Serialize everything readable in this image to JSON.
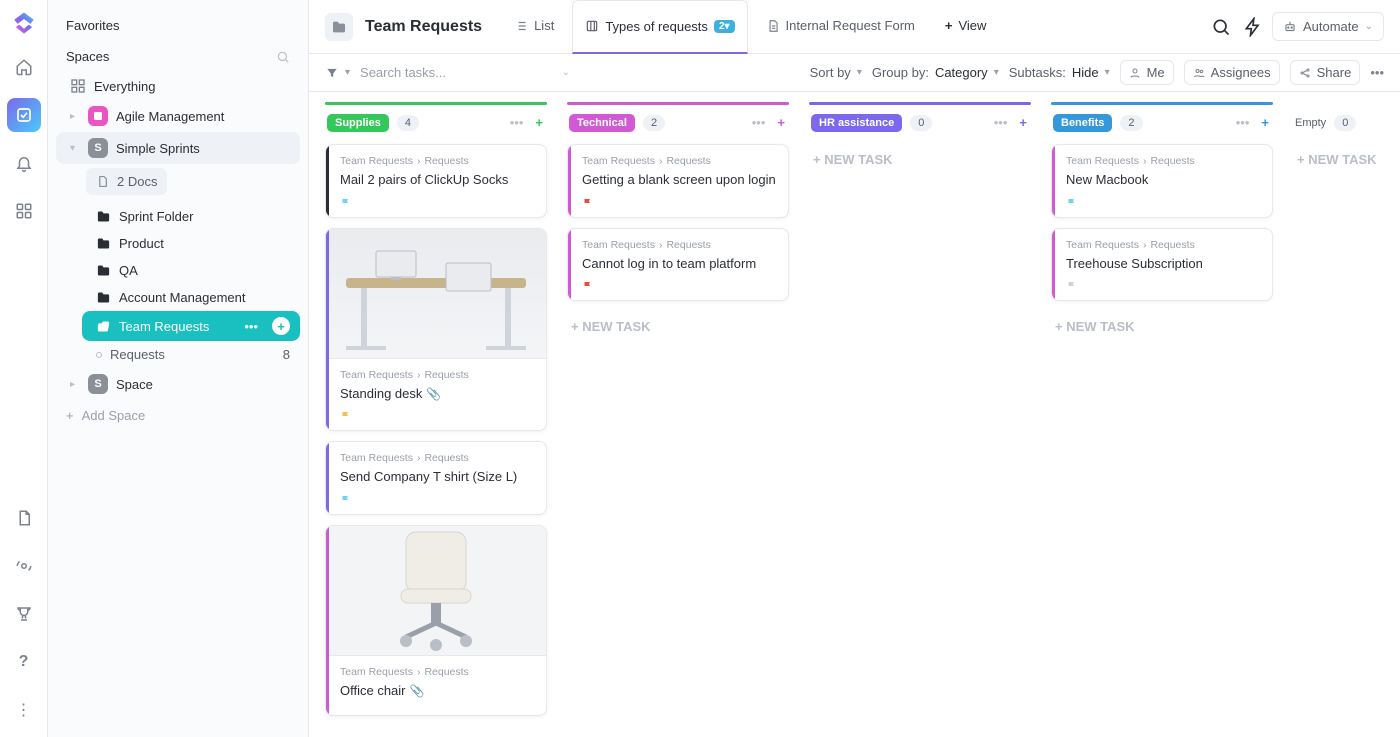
{
  "rail": {
    "logo": "clickup-logo",
    "items": [
      "home-icon",
      "tasks-icon",
      "notifications-icon",
      "apps-icon"
    ],
    "bottom": [
      "doc-icon",
      "pulse-icon",
      "trophy-icon",
      "help-icon",
      "more-icon"
    ]
  },
  "sidebar": {
    "favorites_label": "Favorites",
    "spaces_label": "Spaces",
    "everything_label": "Everything",
    "agile": {
      "label": "Agile Management",
      "initial": ""
    },
    "simple": {
      "label": "Simple Sprints",
      "initial": "S",
      "docs_label": "2 Docs"
    },
    "folders": {
      "sprint": "Sprint Folder",
      "product": "Product",
      "qa": "QA",
      "account": "Account Management",
      "team_requests": "Team Requests",
      "requests": {
        "label": "Requests",
        "count": "8"
      }
    },
    "space": {
      "label": "Space",
      "initial": "S"
    },
    "add_space": "Add Space"
  },
  "header": {
    "title": "Team Requests",
    "tab_list": "List",
    "tab_types": "Types of requests",
    "tab_types_count": "2▾",
    "tab_form": "Internal Request Form",
    "tab_view": "View",
    "automate": "Automate"
  },
  "toolbar": {
    "search_placeholder": "Search tasks...",
    "sort_by": "Sort by",
    "group_by_label": "Group by:",
    "group_by_value": "Category",
    "subtasks_label": "Subtasks:",
    "subtasks_value": "Hide",
    "me": "Me",
    "assignees": "Assignees",
    "share": "Share"
  },
  "board": {
    "crumb_parent": "Team Requests",
    "crumb_child": "Requests",
    "new_task": "+ NEW TASK",
    "columns": [
      {
        "id": "supplies",
        "label": "Supplies",
        "count": "4",
        "stripe": "#34c759",
        "tag_bg": "#34c759",
        "plus_color": "#34c759",
        "cards": [
          {
            "title": "Mail 2 pairs of ClickUp Socks",
            "edge": "#2a2e34",
            "flag": "#6fd3f2",
            "thumb": null
          },
          {
            "title": "Standing desk",
            "edge": "#7b68ee",
            "flag": "#f5c04a",
            "thumb": "desk",
            "attach": true
          },
          {
            "title": "Send Company T shirt (Size L)",
            "edge": "#7b68ee",
            "flag": "#6fd3f2",
            "thumb": null
          },
          {
            "title": "Office chair",
            "edge": "#d259d6",
            "flag": null,
            "thumb": "chair",
            "attach": true
          }
        ]
      },
      {
        "id": "technical",
        "label": "Technical",
        "count": "2",
        "stripe": "#d259d6",
        "tag_bg": "#d259d6",
        "plus_color": "#d259d6",
        "cards": [
          {
            "title": "Getting a blank screen upon login",
            "edge": "#d259d6",
            "flag": "#e74c3c",
            "thumb": null
          },
          {
            "title": "Cannot log in to team platform",
            "edge": "#d259d6",
            "flag": "#e74c3c",
            "thumb": null
          }
        ]
      },
      {
        "id": "hr",
        "label": "HR assistance",
        "count": "0",
        "stripe": "#7b68ee",
        "tag_bg": "#7b68ee",
        "plus_color": "#7b68ee",
        "cards": []
      },
      {
        "id": "benefits",
        "label": "Benefits",
        "count": "2",
        "stripe": "#3498db",
        "tag_bg": "#3498db",
        "plus_color": "#3498db",
        "cards": [
          {
            "title": "New Macbook",
            "edge": "#d259d6",
            "flag": "#6fd3f2",
            "thumb": null
          },
          {
            "title": "Treehouse Subscription",
            "edge": "#d259d6",
            "flag": "#cfd3da",
            "thumb": null
          }
        ]
      },
      {
        "id": "empty",
        "label": "Empty",
        "count": "0",
        "stripe": "transparent",
        "tag_bg": "transparent",
        "plus_color": "#b9bec7",
        "empty": true,
        "cards": []
      }
    ]
  }
}
